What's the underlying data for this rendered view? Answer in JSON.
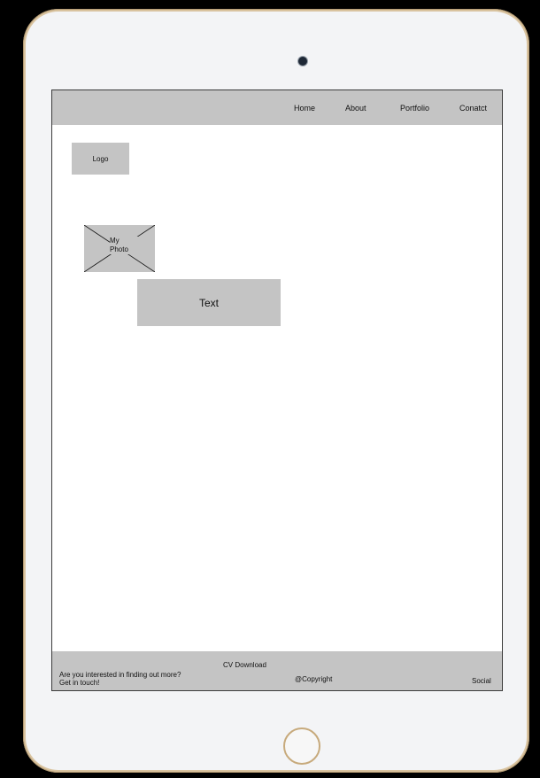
{
  "nav": {
    "items": [
      {
        "label": "Home"
      },
      {
        "label": "About"
      },
      {
        "label": "Portfolio"
      },
      {
        "label": "Conatct"
      }
    ]
  },
  "main": {
    "logo_label": "Logo",
    "photo_label": "My\nPhoto",
    "text_label": "Text"
  },
  "footer": {
    "tagline_line1": "Are you interested in finding out more?",
    "tagline_line2": "Get in touch!",
    "cv_download": "CV Download",
    "copyright": "@Copyright",
    "social": "Social"
  },
  "colors": {
    "wireframe_gray": "#c4c4c4",
    "device_frame": "#d9c39f",
    "device_body": "#f3f4f6"
  }
}
